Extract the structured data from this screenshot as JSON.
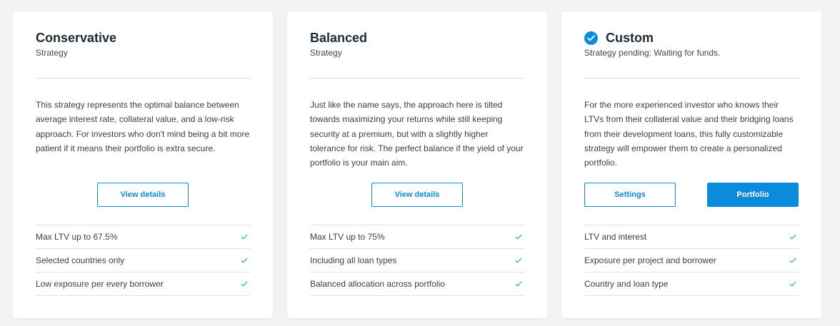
{
  "colors": {
    "accent": "#0a8bdc",
    "check": "#2fb36b",
    "background": "#f2f3f5"
  },
  "cards": [
    {
      "title": "Conservative",
      "subtitle": "Strategy",
      "description": "This strategy represents the optimal balance between average interest rate, collateral value, and a low-risk approach. For investors who don't mind being a bit more patient if it means their portfolio is extra secure.",
      "button_label": "View details",
      "features": [
        {
          "label": "Max LTV up to 67.5%",
          "icon": "checkmark-icon"
        },
        {
          "label": "Selected countries only",
          "icon": "checkmark-icon"
        },
        {
          "label": "Low exposure per every borrower",
          "icon": "checkmark-icon"
        }
      ]
    },
    {
      "title": "Balanced",
      "subtitle": "Strategy",
      "description": "Just like the name says, the approach here is tilted towards maximizing your returns while still keeping security at a premium, but with a slightly higher tolerance for risk. The perfect balance if the yield of your portfolio is your main aim.",
      "button_label": "View details",
      "features": [
        {
          "label": "Max LTV up to 75%",
          "icon": "checkmark-icon"
        },
        {
          "label": "Including all loan types",
          "icon": "checkmark-icon"
        },
        {
          "label": "Balanced allocation across portfolio",
          "icon": "checkmark-icon"
        }
      ]
    },
    {
      "title": "Custom",
      "selected": true,
      "subtitle": "Strategy pending: Waiting for funds.",
      "description": "For the more experienced investor who knows their LTVs from their collateral value and their bridging loans from their development loans, this fully customizable strategy will empower them to create a personalized portfolio.",
      "settings_label": "Settings",
      "portfolio_label": "Portfolio",
      "features": [
        {
          "label": "LTV and interest",
          "icon": "checkmark-icon"
        },
        {
          "label": "Exposure per project and borrower",
          "icon": "checkmark-icon"
        },
        {
          "label": "Country and loan type",
          "icon": "checkmark-icon"
        }
      ]
    }
  ]
}
